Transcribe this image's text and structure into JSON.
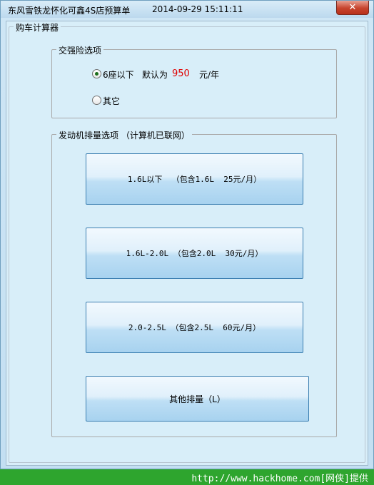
{
  "window": {
    "title": "东风雪铁龙怀化可鑫4S店预算单",
    "datetime": "2014-09-29 15:11:11",
    "close_glyph": "✕"
  },
  "main_group": {
    "title": "购车计算器"
  },
  "insurance": {
    "title": "交强险选项",
    "option1_label": "6座以下",
    "default_prefix": "默认为",
    "price": "950",
    "unit": "元/年",
    "option2_label": "其它",
    "selected": "option1"
  },
  "engine": {
    "title": "发动机排量选项 （计算机已联网）",
    "buttons": [
      "1.6L以下  （包含1.6L  25元/月）",
      "1.6L-2.0L （包含2.0L  30元/月）",
      "2.0-2.5L （包含2.5L  60元/月）",
      "其他排量（L）"
    ]
  },
  "footer": {
    "text": "http://www.hackhome.com[网侠]提供"
  },
  "colors": {
    "price": "#e00000",
    "footer_bg": "#2ea52e"
  }
}
